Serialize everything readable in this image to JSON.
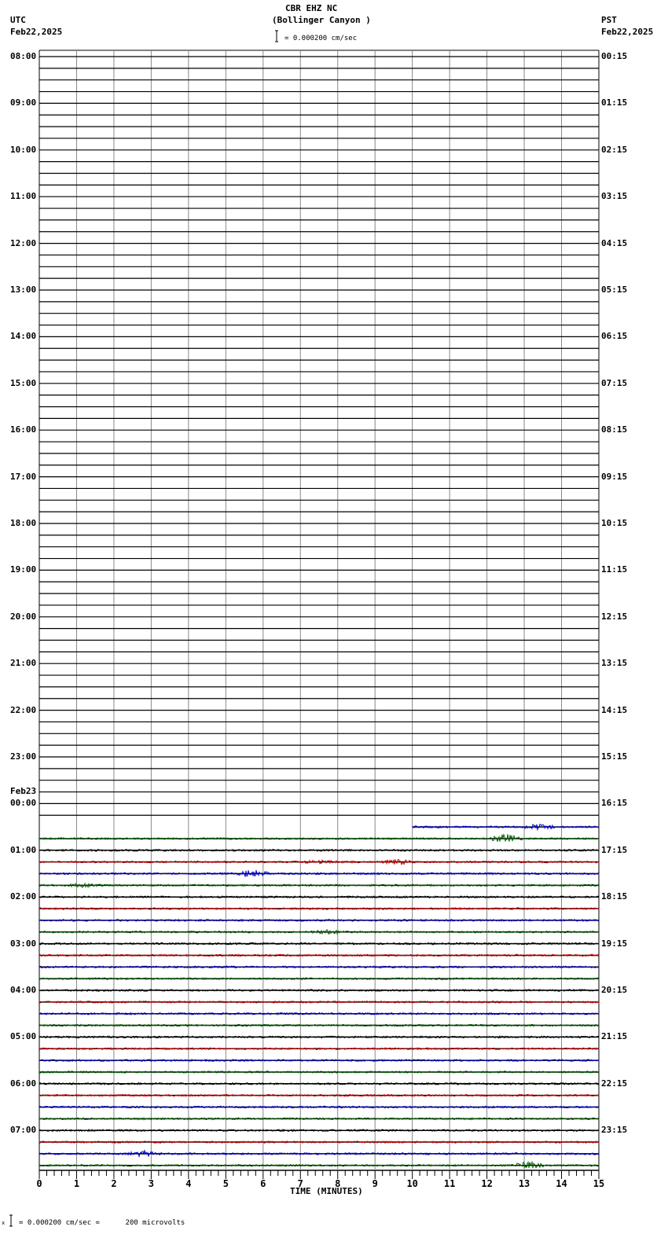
{
  "header": {
    "station": "CBR EHZ NC",
    "location": "(Bollinger Canyon )",
    "left_tz": "UTC",
    "left_date": "Feb22,2025",
    "right_tz": "PST",
    "right_date": "Feb22,2025",
    "scale": "= 0.000200 cm/sec"
  },
  "footer": {
    "scale_prefix": "x",
    "scale": "= 0.000200 cm/sec =      200 microvolts"
  },
  "chart_data": {
    "type": "line",
    "title": "CBR EHZ NC (Bollinger Canyon )",
    "xlabel": "TIME (MINUTES)",
    "xlim": [
      0,
      15
    ],
    "x_ticks": [
      "0",
      "1",
      "2",
      "3",
      "4",
      "5",
      "6",
      "7",
      "8",
      "9",
      "10",
      "11",
      "12",
      "13",
      "14",
      "15"
    ],
    "rows_per_hour": 4,
    "total_rows": 96,
    "trace_colors": [
      "#000000",
      "#d00000",
      "#0000d0",
      "#006000"
    ],
    "data_start_row": 66,
    "data_start_minute": 10,
    "date_change_label": "Feb23",
    "left_labels": [
      "08:00",
      "09:00",
      "10:00",
      "11:00",
      "12:00",
      "13:00",
      "14:00",
      "15:00",
      "16:00",
      "17:00",
      "18:00",
      "19:00",
      "20:00",
      "21:00",
      "22:00",
      "23:00",
      "00:00",
      "01:00",
      "02:00",
      "03:00",
      "04:00",
      "05:00",
      "06:00",
      "07:00"
    ],
    "right_labels": [
      "00:15",
      "01:15",
      "02:15",
      "03:15",
      "04:15",
      "05:15",
      "06:15",
      "07:15",
      "08:15",
      "09:15",
      "10:15",
      "11:15",
      "12:15",
      "13:15",
      "14:15",
      "15:15",
      "16:15",
      "17:15",
      "18:15",
      "19:15",
      "20:15",
      "21:15",
      "22:15",
      "23:15"
    ],
    "events": [
      {
        "row": 66,
        "minute": 13.4,
        "amplitude": 3
      },
      {
        "row": 67,
        "minute": 12.5,
        "amplitude": 5
      },
      {
        "row": 69,
        "minute": 9.6,
        "amplitude": 3
      },
      {
        "row": 69,
        "minute": 7.5,
        "amplitude": 2
      },
      {
        "row": 70,
        "minute": 5.7,
        "amplitude": 5
      },
      {
        "row": 71,
        "minute": 1.2,
        "amplitude": 2
      },
      {
        "row": 75,
        "minute": 7.7,
        "amplitude": 2
      },
      {
        "row": 94,
        "minute": 2.8,
        "amplitude": 3
      },
      {
        "row": 95,
        "minute": 13.1,
        "amplitude": 4
      }
    ]
  }
}
